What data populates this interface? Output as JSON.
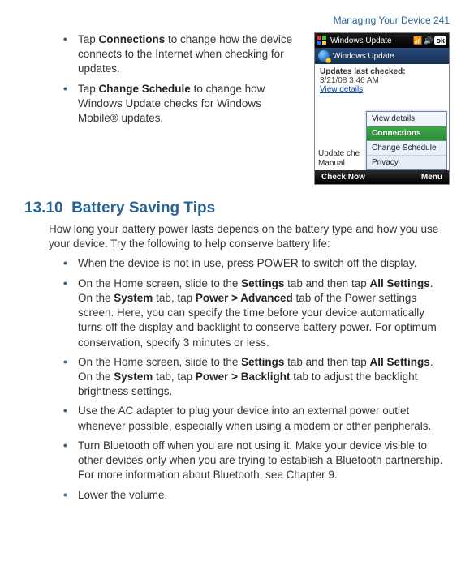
{
  "header": {
    "running_head": "Managing Your Device  241"
  },
  "top_bullets": [
    {
      "pre": "Tap ",
      "bold": "Connections",
      "post": " to change how the device connects to the Internet when checking for updates."
    },
    {
      "pre": "Tap ",
      "bold": "Change Schedule",
      "post": " to change how Windows Update checks for Windows Mobile® updates."
    }
  ],
  "screenshot": {
    "titlebar": {
      "title": "Windows Update",
      "ok": "ok"
    },
    "appbar": {
      "label": "Windows Update"
    },
    "status": {
      "label": "Updates last checked:",
      "date": "3/21/08  3:46 AM",
      "link": "View details"
    },
    "left_cut": {
      "line1": "Update che",
      "line2": "Manual"
    },
    "menu": {
      "items": [
        "View details",
        "Connections",
        "Change Schedule",
        "Privacy"
      ],
      "selected_index": 1
    },
    "softkeys": {
      "left": "Check Now",
      "right": "Menu"
    }
  },
  "section": {
    "number": "13.10",
    "title": "Battery Saving Tips",
    "intro": "How long your battery power lasts depends on the battery type and how you use your device. Try the following to help conserve battery life:"
  },
  "tips": [
    {
      "pre": "When the device is not in use, press POWER to switch off the display."
    },
    {
      "pre": "On the Home screen, slide to the ",
      "b1": "Settings",
      "m1": " tab and then tap ",
      "b2": "All Settings",
      "m2": ". On the ",
      "b3": "System",
      "m3": " tab, tap ",
      "b4": "Power > Advanced",
      "post": " tab of the Power settings screen. Here, you can specify the time before your device automatically turns off the display and backlight to conserve battery power. For optimum conservation, specify 3 minutes or less."
    },
    {
      "pre": "On the Home screen, slide to the ",
      "b1": "Settings",
      "m1": " tab and then tap ",
      "b2": "All Settings",
      "m2": ". On the ",
      "b3": "System",
      "m3": " tab, tap ",
      "b4": "Power > Backlight",
      "post": " tab to adjust the backlight brightness settings."
    },
    {
      "pre": "Use the AC adapter to plug your device into an external power outlet whenever possible, especially when using a modem or other peripherals."
    },
    {
      "pre": "Turn Bluetooth off when you are not using it. Make your device visible to other devices only when you are trying to establish a Bluetooth partnership. For more information about Bluetooth, see Chapter 9."
    },
    {
      "pre": "Lower the volume."
    }
  ]
}
